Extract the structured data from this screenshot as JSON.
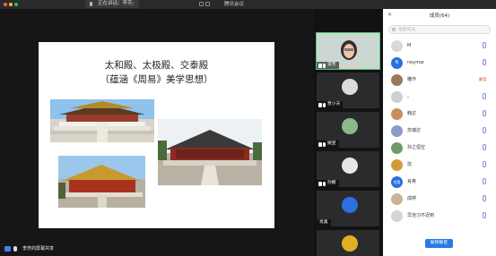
{
  "window": {
    "title": "腾讯会议"
  },
  "speaking": {
    "label": "正在讲话：李芳;"
  },
  "slide": {
    "title_line1": "太和殿、太极殿、交泰殿",
    "title_line2": "（蕴涵《周易》美学思想）"
  },
  "presenter": {
    "label": "李芳的屏幕共享"
  },
  "video_tiles": [
    {
      "name": "李芳"
    },
    {
      "name": "贾小天"
    },
    {
      "name": "姚昱"
    },
    {
      "name": "孙鹏"
    },
    {
      "name": "肖奥"
    },
    {
      "name": ""
    }
  ],
  "members_panel": {
    "title": "成员(64)",
    "search_placeholder": "搜索成员",
    "members": [
      {
        "name": "M",
        "avatar_color": "#d9d9d9"
      },
      {
        "name": "neymar",
        "avatar_text": "N",
        "avatar_color": "#2b6fe0"
      },
      {
        "name": "雕作",
        "avatar_color": "#9a7a5a",
        "tag": "静音"
      },
      {
        "name": "。",
        "avatar_color": "#cfcfcf"
      },
      {
        "name": "韩达",
        "avatar_color": "#c68f59"
      },
      {
        "name": "苏瑞达",
        "avatar_color": "#8b9bc9"
      },
      {
        "name": "孙之恒空",
        "avatar_color": "#6e9a6a"
      },
      {
        "name": "玟",
        "avatar_color": "#d49a3a"
      },
      {
        "name": "肖奥",
        "avatar_text": "肖奥",
        "avatar_color": "#2b6fe0"
      },
      {
        "name": "成婷",
        "avatar_color": "#c9b296"
      },
      {
        "name": "早自习不迟到",
        "avatar_color": "#d5d5d5"
      }
    ],
    "mute_all_label": "解除静音"
  },
  "colors": {
    "accent": "#2a7ae4",
    "active_speaker": "#4fc96b",
    "slide_bg": "#ffffff"
  },
  "icons": [
    "mic-icon",
    "search-icon",
    "close-icon",
    "avatar"
  ]
}
